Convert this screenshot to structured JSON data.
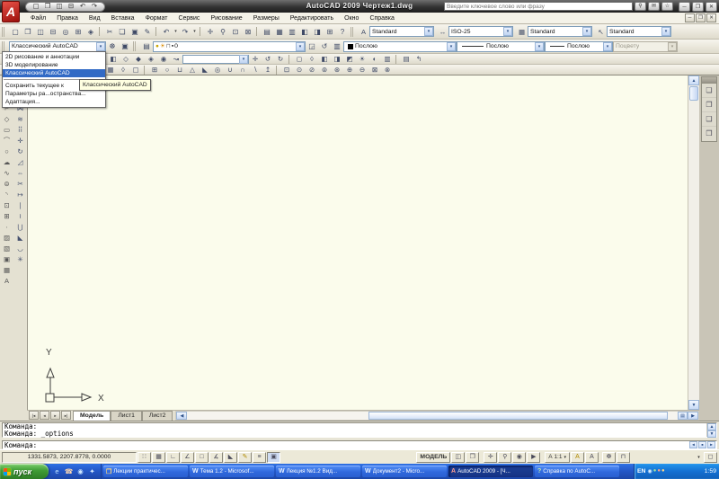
{
  "window": {
    "title": "AutoCAD 2009 Чертеж1.dwg",
    "search": {
      "placeholder": "Введите ключевое слово или фразу"
    },
    "qat_icons": [
      {
        "name": "new-file-icon",
        "glyph": "▢"
      },
      {
        "name": "open-file-icon",
        "glyph": "❐"
      },
      {
        "name": "save-icon",
        "glyph": "◫"
      },
      {
        "name": "plot-icon",
        "glyph": "⊟"
      },
      {
        "name": "undo-icon",
        "glyph": "↶"
      },
      {
        "name": "redo-icon",
        "glyph": "↷"
      }
    ],
    "search_icons": [
      {
        "name": "search-icon",
        "glyph": "⚲"
      },
      {
        "name": "communication-center-icon",
        "glyph": "✉"
      },
      {
        "name": "favorites-icon",
        "glyph": "☆"
      }
    ],
    "window_buttons": [
      {
        "name": "minimize-button",
        "glyph": "─"
      },
      {
        "name": "maximize-button",
        "glyph": "❐"
      },
      {
        "name": "close-button",
        "glyph": "✕"
      }
    ]
  },
  "menubar": {
    "items": [
      {
        "label": "Файл"
      },
      {
        "label": "Правка"
      },
      {
        "label": "Вид"
      },
      {
        "label": "Вставка"
      },
      {
        "label": "Формат"
      },
      {
        "label": "Сервис"
      },
      {
        "label": "Рисование"
      },
      {
        "label": "Размеры"
      },
      {
        "label": "Редактировать"
      },
      {
        "label": "Окно"
      },
      {
        "label": "Справка"
      }
    ],
    "doc_buttons": [
      {
        "name": "doc-minimize-button",
        "glyph": "─"
      },
      {
        "name": "doc-restore-button",
        "glyph": "❐"
      },
      {
        "name": "doc-close-button",
        "glyph": "✕"
      }
    ]
  },
  "standard_toolbar": {
    "icons": [
      {
        "name": "new-icon",
        "glyph": "▢"
      },
      {
        "name": "open-icon",
        "glyph": "❐"
      },
      {
        "name": "save-icon",
        "glyph": "◫"
      },
      {
        "name": "plot-icon",
        "glyph": "⊟"
      },
      {
        "name": "plot-preview-icon",
        "glyph": "◎"
      },
      {
        "name": "publish-icon",
        "glyph": "⊞"
      },
      {
        "name": "3d-dwf-icon",
        "glyph": "◈"
      },
      {
        "cls": "sep"
      },
      {
        "name": "cut-icon",
        "glyph": "✂"
      },
      {
        "name": "copy-icon",
        "glyph": "❏"
      },
      {
        "name": "paste-icon",
        "glyph": "▣"
      },
      {
        "name": "match-properties-icon",
        "glyph": "✎"
      },
      {
        "cls": "sep"
      },
      {
        "name": "undo-icon",
        "glyph": "↶"
      },
      {
        "name": "undo-list-icon",
        "glyph": "▾",
        "cls": "dd"
      },
      {
        "name": "redo-icon",
        "glyph": "↷"
      },
      {
        "name": "redo-list-icon",
        "glyph": "▾",
        "cls": "dd"
      },
      {
        "cls": "sep"
      },
      {
        "name": "pan-icon",
        "glyph": "✛"
      },
      {
        "name": "zoom-realtime-icon",
        "glyph": "⚲"
      },
      {
        "name": "zoom-window-icon",
        "glyph": "⊡"
      },
      {
        "name": "zoom-previous-icon",
        "glyph": "⊠"
      },
      {
        "cls": "sep"
      },
      {
        "name": "properties-icon",
        "glyph": "▤"
      },
      {
        "name": "designcenter-icon",
        "glyph": "▦"
      },
      {
        "name": "tool-palettes-icon",
        "glyph": "▥"
      },
      {
        "name": "sheet-set-manager-icon",
        "glyph": "◧"
      },
      {
        "name": "markup-set-manager-icon",
        "glyph": "◨"
      },
      {
        "name": "quickcalc-icon",
        "glyph": "⊞"
      },
      {
        "name": "help-icon",
        "glyph": "?"
      }
    ]
  },
  "styles_toolbar": {
    "text_style": {
      "icon": "A",
      "value": "Standard"
    },
    "dim_style": {
      "icon": "↔",
      "value": "ISO-25"
    },
    "table_style": {
      "icon": "▦",
      "value": "Standard"
    },
    "mleader_style": {
      "icon": "↖",
      "value": "Standard"
    }
  },
  "workspace_toolbar": {
    "combo_value": "Классический AutoCAD",
    "icons": [
      {
        "name": "workspace-settings-icon",
        "glyph": "☸"
      },
      {
        "name": "my-workspace-icon",
        "glyph": "▣"
      }
    ]
  },
  "layers_toolbar": {
    "properties_icon": "▤",
    "combo": {
      "bulb": "●",
      "sun": "☀",
      "lock": "⊓",
      "swatch": "▪",
      "value": "0"
    },
    "icons": [
      {
        "name": "make-object-layer-current-icon",
        "glyph": "◲"
      },
      {
        "name": "layer-previous-icon",
        "glyph": "↺"
      },
      {
        "name": "layer-states-icon",
        "glyph": "▥"
      }
    ]
  },
  "properties_toolbar": {
    "color_value": "Послою",
    "linetype_value": "Послою",
    "lineweight_value": "Послою",
    "plot_style_value": "Поцвету"
  },
  "view_toolbar": {
    "icons1": [
      {
        "name": "named-views-icon",
        "glyph": "◧"
      },
      {
        "name": "top-view-icon",
        "glyph": "◇"
      },
      {
        "name": "iso-view-sw-icon",
        "glyph": "◆"
      },
      {
        "name": "iso-view-se-icon",
        "glyph": "◈"
      },
      {
        "name": "camera-icon",
        "glyph": "◉"
      },
      {
        "name": "motion-path-icon",
        "glyph": "↝"
      }
    ],
    "views_combo_value": "",
    "icons2": [
      {
        "name": "pan-icon",
        "glyph": "✛"
      },
      {
        "name": "orbit-icon",
        "glyph": "↺"
      },
      {
        "name": "continuous-orbit-icon",
        "glyph": "↻"
      }
    ],
    "icons3": [
      {
        "name": "visual-style-2d-icon",
        "glyph": "◻"
      },
      {
        "name": "visual-style-wireframe-icon",
        "glyph": "◊"
      },
      {
        "name": "visual-style-hidden-icon",
        "glyph": "◧"
      },
      {
        "name": "visual-style-conceptual-icon",
        "glyph": "◨"
      },
      {
        "name": "visual-style-realistic-icon",
        "glyph": "◩"
      },
      {
        "name": "sun-status-icon",
        "glyph": "☀"
      },
      {
        "name": "render-icon",
        "glyph": "◐"
      },
      {
        "name": "render-window-icon",
        "glyph": "▥"
      }
    ],
    "icons4": [
      {
        "name": "render-region-icon",
        "glyph": "▤"
      },
      {
        "name": "render-presets-icon",
        "glyph": "↰"
      }
    ]
  },
  "modeling_toolbar": {
    "icons1": [
      {
        "name": "ucs-icon",
        "glyph": "∷"
      },
      {
        "name": "ucs-world-icon",
        "glyph": "▦"
      },
      {
        "name": "3d-face-icon",
        "glyph": "◊"
      },
      {
        "name": "view-manager-icon",
        "glyph": "▢"
      }
    ],
    "icons2": [
      {
        "name": "box-icon",
        "glyph": "⊞"
      },
      {
        "name": "sphere-icon",
        "glyph": "○"
      },
      {
        "name": "cylinder-icon",
        "glyph": "⊔"
      },
      {
        "name": "cone-icon",
        "glyph": "△"
      },
      {
        "name": "wedge-icon",
        "glyph": "◣"
      },
      {
        "name": "torus-icon",
        "glyph": "◎"
      },
      {
        "name": "union-icon",
        "glyph": "∪"
      },
      {
        "name": "intersect-icon",
        "glyph": "∩"
      },
      {
        "name": "subtract-icon",
        "glyph": "∖"
      },
      {
        "name": "extrude-icon",
        "glyph": "↥"
      }
    ],
    "icons3": [
      {
        "name": "zoom-window-icon",
        "glyph": "⊡"
      },
      {
        "name": "zoom-dynamic-icon",
        "glyph": "⊙"
      },
      {
        "name": "zoom-scale-icon",
        "glyph": "⊘"
      },
      {
        "name": "zoom-center-icon",
        "glyph": "⊚"
      },
      {
        "name": "zoom-object-icon",
        "glyph": "⊛"
      },
      {
        "name": "zoom-in-icon",
        "glyph": "⊕"
      },
      {
        "name": "zoom-out-icon",
        "glyph": "⊖"
      },
      {
        "name": "zoom-all-icon",
        "glyph": "⊠"
      },
      {
        "name": "zoom-extents-icon",
        "glyph": "⊗"
      }
    ]
  },
  "draw_toolbar": {
    "icons": [
      {
        "name": "line-icon",
        "glyph": "╱"
      },
      {
        "name": "construction-line-icon",
        "glyph": "╳"
      },
      {
        "name": "polyline-icon",
        "glyph": "⌐"
      },
      {
        "name": "polygon-icon",
        "glyph": "◇"
      },
      {
        "name": "rectangle-icon",
        "glyph": "▭"
      },
      {
        "name": "arc-icon",
        "glyph": "⌒"
      },
      {
        "name": "circle-icon",
        "glyph": "○"
      },
      {
        "name": "revcloud-icon",
        "glyph": "☁"
      },
      {
        "name": "spline-icon",
        "glyph": "∿"
      },
      {
        "name": "ellipse-icon",
        "glyph": "⊜"
      },
      {
        "name": "ellipse-arc-icon",
        "glyph": "◝"
      },
      {
        "name": "insert-block-icon",
        "glyph": "⊡"
      },
      {
        "name": "make-block-icon",
        "glyph": "⊞"
      },
      {
        "name": "point-icon",
        "glyph": "∙"
      },
      {
        "name": "hatch-icon",
        "glyph": "▨"
      },
      {
        "name": "gradient-icon",
        "glyph": "▧"
      },
      {
        "name": "region-icon",
        "glyph": "▣"
      },
      {
        "name": "table-icon",
        "glyph": "▦"
      },
      {
        "name": "multiline-text-icon",
        "glyph": "A"
      }
    ]
  },
  "modify_toolbar": {
    "icons": [
      {
        "name": "erase-icon",
        "glyph": "◪"
      },
      {
        "name": "copy-icon",
        "glyph": "❏"
      },
      {
        "name": "mirror-icon",
        "glyph": "⋈"
      },
      {
        "name": "offset-icon",
        "glyph": "≋"
      },
      {
        "name": "array-icon",
        "glyph": "⠿"
      },
      {
        "name": "move-icon",
        "glyph": "✛"
      },
      {
        "name": "rotate-icon",
        "glyph": "↻"
      },
      {
        "name": "scale-icon",
        "glyph": "◿"
      },
      {
        "name": "stretch-icon",
        "glyph": "⇔"
      },
      {
        "name": "trim-icon",
        "glyph": "✂"
      },
      {
        "name": "extend-icon",
        "glyph": "↦"
      },
      {
        "name": "break-at-point-icon",
        "glyph": "∣"
      },
      {
        "name": "break-icon",
        "glyph": "≀"
      },
      {
        "name": "join-icon",
        "glyph": "⋃"
      },
      {
        "name": "chamfer-icon",
        "glyph": "◣"
      },
      {
        "name": "fillet-icon",
        "glyph": "◡"
      },
      {
        "name": "explode-icon",
        "glyph": "✳"
      }
    ]
  },
  "draworder_palette": {
    "icons": [
      {
        "name": "bring-to-front-icon",
        "glyph": "❏"
      },
      {
        "name": "send-to-back-icon",
        "glyph": "❐"
      },
      {
        "name": "bring-above-objects-icon",
        "glyph": "❑"
      },
      {
        "name": "send-under-objects-icon",
        "glyph": "❒"
      }
    ]
  },
  "canvas": {
    "ucs": {
      "x_label": "X",
      "y_label": "Y"
    }
  },
  "tabs": {
    "nav": [
      {
        "name": "first-tab-icon",
        "glyph": "|◂"
      },
      {
        "name": "prev-tab-icon",
        "glyph": "◂"
      },
      {
        "name": "next-tab-icon",
        "glyph": "▸"
      },
      {
        "name": "last-tab-icon",
        "glyph": "▸|"
      }
    ],
    "items": [
      {
        "label": "Модель",
        "cls": "active"
      },
      {
        "label": "Лист1"
      },
      {
        "label": "Лист2"
      }
    ]
  },
  "workspace_dropdown": {
    "items": [
      {
        "label": "2D рисование и аннотации"
      },
      {
        "label": "3D моделирование"
      },
      {
        "label": "Классический AutoCAD",
        "cls": "selected"
      },
      {
        "cls": "sepline"
      },
      {
        "label": "Сохранить текущее к"
      },
      {
        "label": "Параметры ра...остранства..."
      },
      {
        "label": "Адаптация..."
      }
    ],
    "tooltip": "Классический AutoCAD"
  },
  "command_window": {
    "history": [
      {
        "text": "Команда:"
      },
      {
        "text": "Команда: _options"
      }
    ],
    "input": "Команда:"
  },
  "statusbar": {
    "coords": "1331.5873, 2207.8778, 0.0000",
    "toggles": [
      {
        "name": "snap-toggle",
        "glyph": "∷"
      },
      {
        "name": "grid-toggle",
        "glyph": "▦"
      },
      {
        "name": "ortho-toggle",
        "glyph": "∟"
      },
      {
        "name": "polar-toggle",
        "glyph": "∠"
      },
      {
        "name": "osnap-toggle",
        "glyph": "□"
      },
      {
        "name": "otrack-toggle",
        "glyph": "∡"
      },
      {
        "name": "ducs-toggle",
        "glyph": "◣"
      },
      {
        "name": "dyn-toggle",
        "glyph": "✎",
        "color": "#b08a00"
      },
      {
        "name": "lwt-toggle",
        "glyph": "≡"
      },
      {
        "name": "qp-toggle",
        "glyph": "▣",
        "cls": "pressed"
      }
    ],
    "model_label": "МОДЕЛЬ",
    "right_icons1": [
      {
        "name": "quick-view-layouts-icon",
        "glyph": "◫"
      },
      {
        "name": "quick-view-drawings-icon",
        "glyph": "❐"
      }
    ],
    "right_icons2": [
      {
        "name": "pan-icon",
        "glyph": "✛"
      },
      {
        "name": "zoom-icon",
        "glyph": "⚲"
      },
      {
        "name": "steering-wheel-icon",
        "glyph": "◉"
      },
      {
        "name": "showmotion-icon",
        "glyph": "▶"
      }
    ],
    "annotation_scale": "А 1:1",
    "right_icons3": [
      {
        "name": "annotation-visibility-icon",
        "glyph": "А",
        "color": "#b08a00"
      },
      {
        "name": "annotation-autoscale-icon",
        "glyph": "А"
      }
    ],
    "right_icons4": [
      {
        "name": "workspace-switching-icon",
        "glyph": "☸"
      },
      {
        "name": "toolbar-lock-icon",
        "glyph": "⊓"
      }
    ],
    "tray_arrow": "▾",
    "clean_screen_glyph": "◻"
  },
  "taskbar": {
    "start_label": "пуск",
    "quick_launch": [
      {
        "name": "internet-explorer-icon",
        "glyph": "e",
        "color": "#bfe3ff"
      },
      {
        "name": "phone-icon",
        "glyph": "☎",
        "color": "#ffd9b0"
      },
      {
        "name": "media-player-icon",
        "glyph": "◉",
        "color": "#cfe8ff"
      },
      {
        "name": "messenger-icon",
        "glyph": "✦",
        "color": "#d8ecff"
      }
    ],
    "tasks": [
      {
        "name": "task-folder",
        "label": "Лекции практичес...",
        "icon_glyph": "❒",
        "icon_color": "#ffd87a"
      },
      {
        "name": "task-word-1",
        "label": "Тема 1.2 - Microsof...",
        "icon_glyph": "W",
        "icon_color": "#e8f1ff"
      },
      {
        "name": "task-word-2",
        "label": "Лекция №1.2 Вид...",
        "icon_glyph": "W",
        "icon_color": "#e8f1ff"
      },
      {
        "name": "task-word-3",
        "label": "Документ2 - Micro...",
        "icon_glyph": "W",
        "icon_color": "#e8f1ff"
      },
      {
        "name": "task-autocad",
        "label": "AutoCAD 2009 - [Ч...",
        "icon_glyph": "A",
        "icon_color": "#ff9d8f",
        "cls": "active"
      },
      {
        "name": "task-help",
        "label": "Справка по AutoC...",
        "icon_glyph": "?",
        "icon_color": "#bce8a8"
      }
    ],
    "tray": {
      "lang": "EN",
      "icons": [
        {
          "name": "volume-icon",
          "glyph": "◉",
          "color": "#dff0ff"
        },
        {
          "name": "antivirus-icon",
          "glyph": "●",
          "color": "#9fe09f"
        },
        {
          "name": "alert-icon",
          "glyph": "●",
          "color": "#ff9d8a"
        },
        {
          "name": "update-icon",
          "glyph": "●",
          "color": "#ffd78a"
        }
      ],
      "time": "1:59"
    }
  },
  "ui": {
    "combo_arrow": "▾",
    "up": "▲",
    "down": "▼",
    "left": "◀",
    "right": "▶",
    "hgrip": "▤",
    "thumb_dot": "▪",
    "logo_letter": "A"
  },
  "colors": {
    "selection": "#316ac5",
    "canvas": "#fbfcec",
    "taskbar_blue": "#2458c8",
    "autocad_red": "#b01217"
  }
}
